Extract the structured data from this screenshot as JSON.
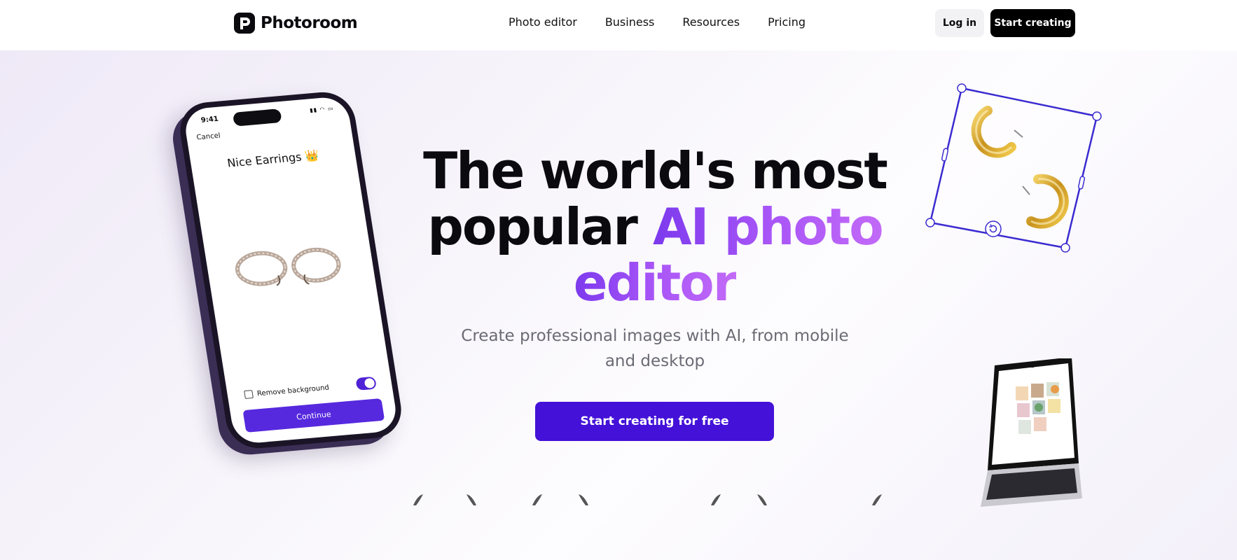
{
  "nav": {
    "brand": "Photoroom",
    "links": [
      "Photo editor",
      "Business",
      "Resources",
      "Pricing"
    ],
    "login_label": "Log in",
    "start_label": "Start creating"
  },
  "hero": {
    "headline_part1": "The world's most",
    "headline_part2": "popular ",
    "headline_accent1": "AI photo",
    "headline_accent2": "editor",
    "subheadline": "Create professional images with AI, from mobile and desktop",
    "cta_label": "Start creating for free"
  },
  "phone": {
    "time": "9:41",
    "cancel_label": "Cancel",
    "project_title": "Nice Earrings 👑",
    "remove_bg_label": "Remove background",
    "remove_bg_enabled": true,
    "continue_label": "Continue"
  },
  "colors": {
    "accent": "#4411d8",
    "gradient_start": "#7c3aed",
    "gradient_end": "#c26af7",
    "selection_stroke": "#3b2bd0"
  },
  "icons": [
    "logo-icon",
    "cancel-icon",
    "remove-background-icon",
    "rotate-icon",
    "laurel-icon"
  ]
}
